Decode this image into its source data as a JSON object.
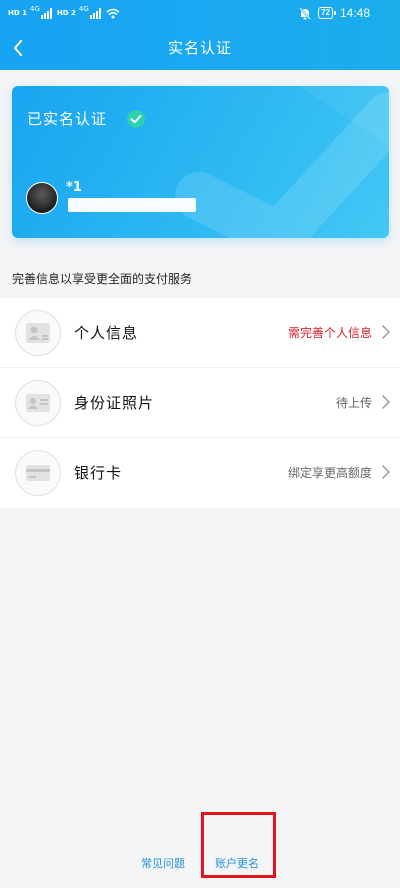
{
  "status_bar": {
    "hd1": "HD 1",
    "hd2": "HD 2",
    "net1": "4G",
    "net2": "4G",
    "battery": "72",
    "time": "14:48"
  },
  "nav": {
    "title": "实名认证"
  },
  "card": {
    "verified_label": "已实名认证",
    "name_fragment": "*1"
  },
  "hint": "完善信息以享受更全面的支付服务",
  "rows": [
    {
      "label": "个人信息",
      "status": "需完善个人信息",
      "icon": "id-person-icon"
    },
    {
      "label": "身份证照片",
      "status": "待上传",
      "icon": "id-card-icon"
    },
    {
      "label": "银行卡",
      "status": "绑定享更高额度",
      "icon": "bank-card-icon"
    }
  ],
  "footer": {
    "faq": "常见问题",
    "rename": "账户更名"
  },
  "colors": {
    "brand": "#1aa4f2",
    "warning": "#d0232b",
    "link": "#2292d6",
    "highlight": "#e5131b"
  }
}
